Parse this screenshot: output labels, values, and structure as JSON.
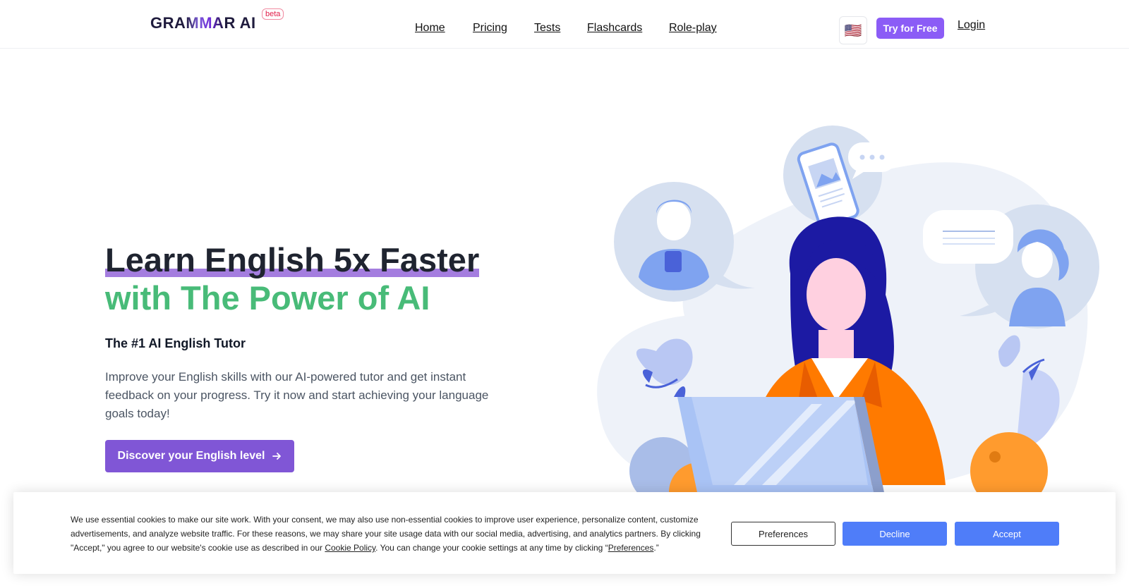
{
  "header": {
    "logo": {
      "part1": "GRA",
      "part2": "MMA",
      "part3": "R AI"
    },
    "beta_label": "beta",
    "nav": [
      {
        "label": "Home"
      },
      {
        "label": "Pricing"
      },
      {
        "label": "Tests"
      },
      {
        "label": "Flashcards"
      },
      {
        "label": "Role-play"
      }
    ],
    "flag_emoji": "🇺🇸",
    "try_label": "Try for Free",
    "login_label": "Login"
  },
  "hero": {
    "title_line1": "Learn English 5x Faster",
    "title_line2": "with The Power of AI",
    "subheading": "The #1 AI English Tutor",
    "description": "Improve your English skills with our AI-powered tutor and get instant feedback on your progress. Try it now and start achieving your language goals today!",
    "cta_label": "Discover your English level",
    "cta_icon": "arrow-right-icon"
  },
  "colors": {
    "accent_purple": "#8b5cf6",
    "title_green": "#48bb78",
    "cookie_button_blue": "#4f7df9"
  },
  "cookie": {
    "text_part1": "We use essential cookies to make our site work. With your consent, we may also use non-essential cookies to improve user experience, personalize content, customize advertisements, and analyze website traffic. For these reasons, we may share your site usage data with our social media, advertising, and analytics partners. By clicking \"Accept,\" you agree to our website's cookie use as described in our ",
    "policy_link": "Cookie Policy",
    "text_part2": ". You can change your cookie settings at any time by clicking “",
    "preferences_link": "Preferences",
    "text_part3": ".”",
    "preferences_label": "Preferences",
    "decline_label": "Decline",
    "accept_label": "Accept"
  }
}
